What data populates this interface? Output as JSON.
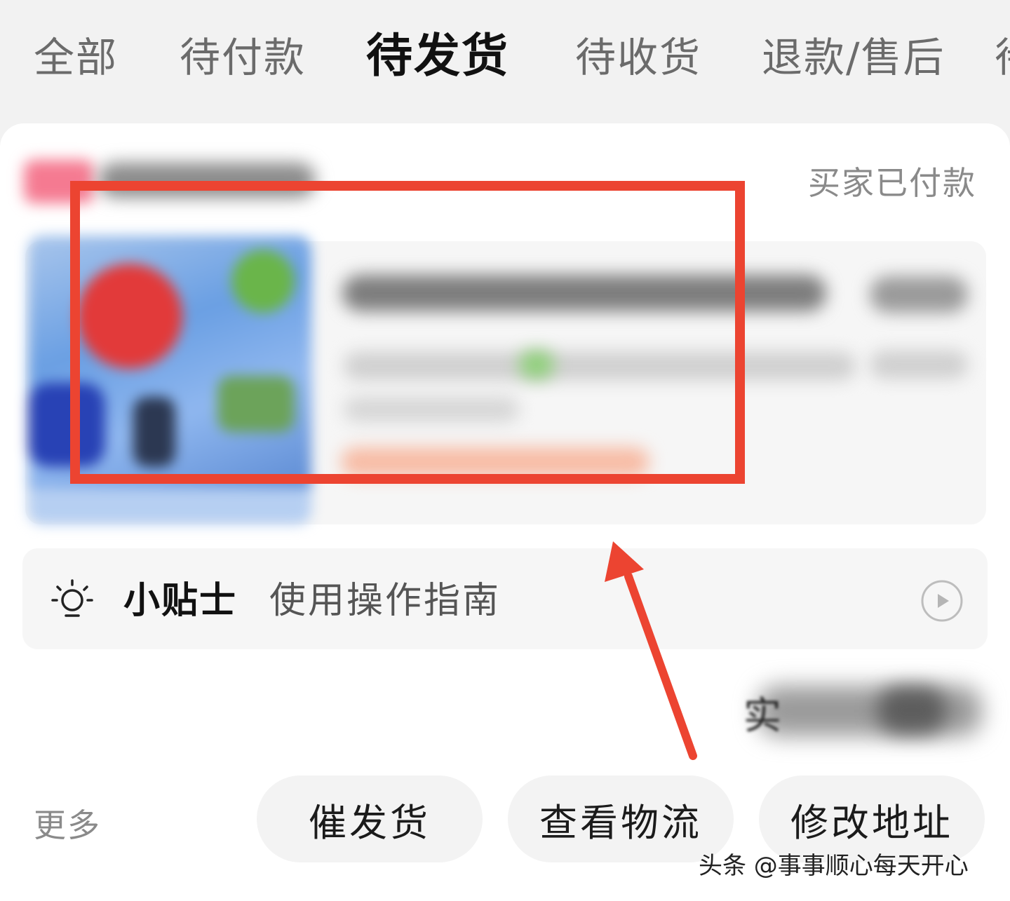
{
  "tabs": [
    {
      "label": "全部"
    },
    {
      "label": "待付款"
    },
    {
      "label": "待发货",
      "active": true
    },
    {
      "label": "待收货"
    },
    {
      "label": "退款/售后"
    }
  ],
  "order": {
    "status": "买家已付款"
  },
  "tips": {
    "title": "小贴士",
    "text": "使用操作指南",
    "icon": "lightbulb-icon",
    "action_icon": "play-circle-icon"
  },
  "actions": {
    "more_label": "更多",
    "buttons": [
      "催发货",
      "查看物流",
      "修改地址"
    ]
  },
  "watermark": "头条 @事事顺心每天开心",
  "colors": {
    "highlight": "#ec4431",
    "background": "#f2f2f2",
    "card": "#ffffff"
  }
}
